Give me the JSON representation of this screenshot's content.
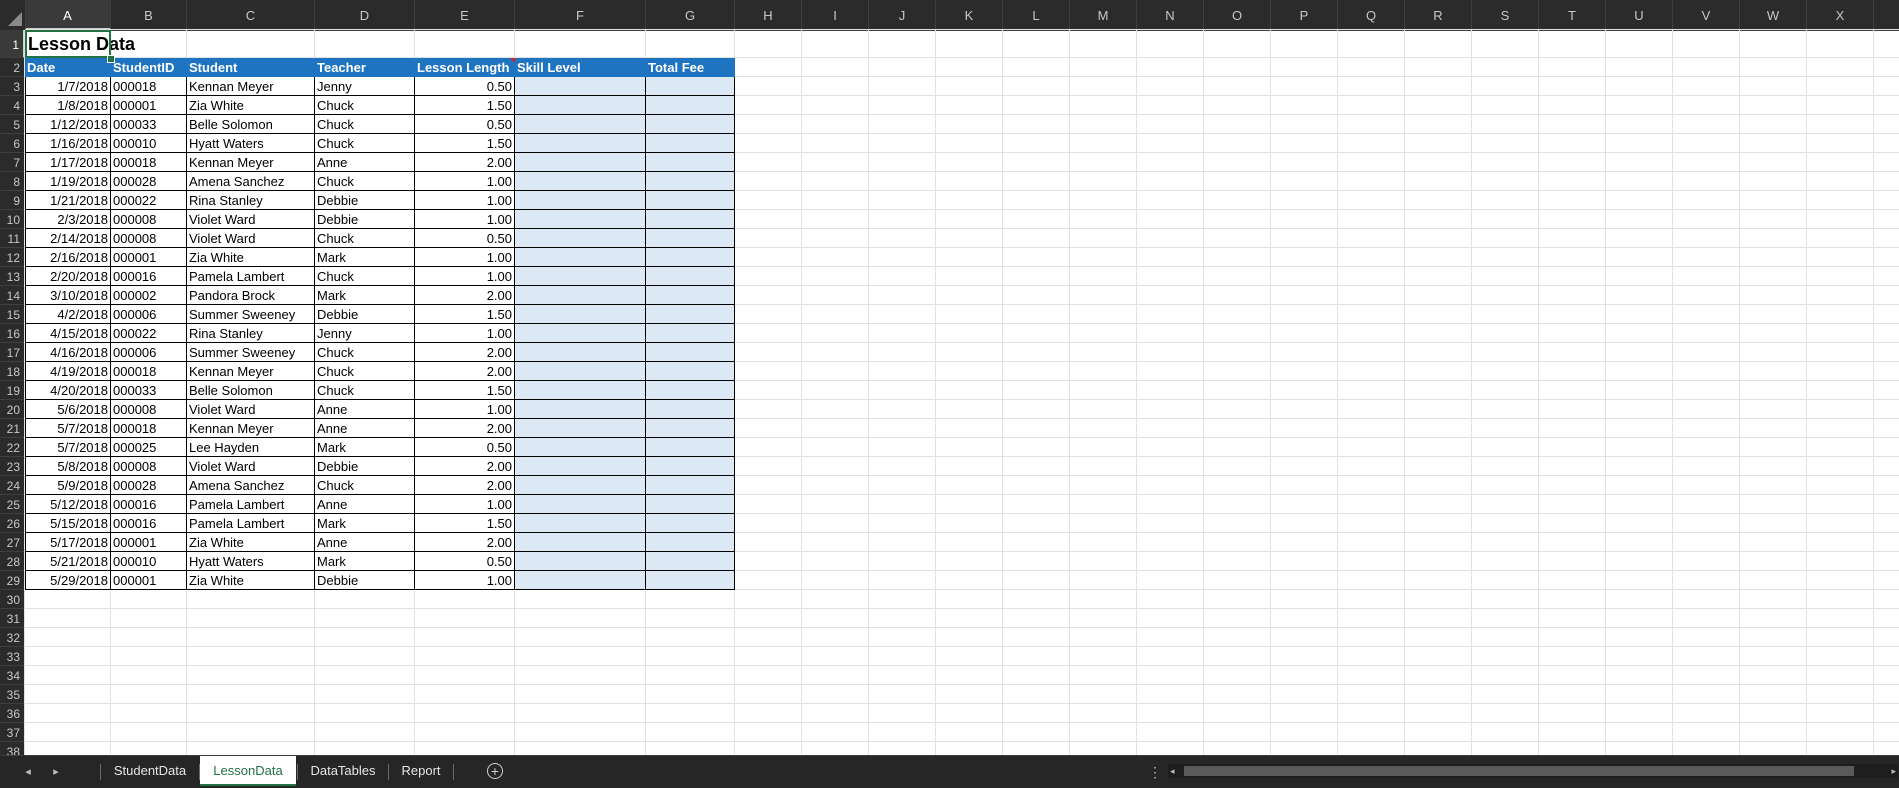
{
  "columns": [
    "A",
    "B",
    "C",
    "D",
    "E",
    "F",
    "G",
    "H",
    "I",
    "J",
    "K",
    "L",
    "M",
    "N",
    "O",
    "P",
    "Q",
    "R",
    "S",
    "T",
    "U",
    "V",
    "W",
    "X"
  ],
  "active_column": "A",
  "rows": [
    "1",
    "2",
    "3",
    "4",
    "5",
    "6",
    "7",
    "8",
    "9",
    "10",
    "11",
    "12",
    "13",
    "14",
    "15",
    "16",
    "17",
    "18",
    "19",
    "20",
    "21",
    "22",
    "23",
    "24",
    "25",
    "26",
    "27",
    "28",
    "29",
    "30",
    "31",
    "32",
    "33",
    "34",
    "35",
    "36",
    "37",
    "38"
  ],
  "active_row": "1",
  "sheet_title": "Lesson Data",
  "table_headers": [
    "Date",
    "StudentID",
    "Student",
    "Teacher",
    "Lesson Length",
    "Skill Level",
    "Total Fee"
  ],
  "table_rows": [
    [
      "1/7/2018",
      "000018",
      "Kennan Meyer",
      "Jenny",
      "0.50",
      "",
      ""
    ],
    [
      "1/8/2018",
      "000001",
      "Zia White",
      "Chuck",
      "1.50",
      "",
      ""
    ],
    [
      "1/12/2018",
      "000033",
      "Belle Solomon",
      "Chuck",
      "0.50",
      "",
      ""
    ],
    [
      "1/16/2018",
      "000010",
      "Hyatt Waters",
      "Chuck",
      "1.50",
      "",
      ""
    ],
    [
      "1/17/2018",
      "000018",
      "Kennan Meyer",
      "Anne",
      "2.00",
      "",
      ""
    ],
    [
      "1/19/2018",
      "000028",
      "Amena Sanchez",
      "Chuck",
      "1.00",
      "",
      ""
    ],
    [
      "1/21/2018",
      "000022",
      "Rina Stanley",
      "Debbie",
      "1.00",
      "",
      ""
    ],
    [
      "2/3/2018",
      "000008",
      "Violet Ward",
      "Debbie",
      "1.00",
      "",
      ""
    ],
    [
      "2/14/2018",
      "000008",
      "Violet Ward",
      "Chuck",
      "0.50",
      "",
      ""
    ],
    [
      "2/16/2018",
      "000001",
      "Zia White",
      "Mark",
      "1.00",
      "",
      ""
    ],
    [
      "2/20/2018",
      "000016",
      "Pamela Lambert",
      "Chuck",
      "1.00",
      "",
      ""
    ],
    [
      "3/10/2018",
      "000002",
      "Pandora Brock",
      "Mark",
      "2.00",
      "",
      ""
    ],
    [
      "4/2/2018",
      "000006",
      "Summer Sweeney",
      "Debbie",
      "1.50",
      "",
      ""
    ],
    [
      "4/15/2018",
      "000022",
      "Rina Stanley",
      "Jenny",
      "1.00",
      "",
      ""
    ],
    [
      "4/16/2018",
      "000006",
      "Summer Sweeney",
      "Chuck",
      "2.00",
      "",
      ""
    ],
    [
      "4/19/2018",
      "000018",
      "Kennan Meyer",
      "Chuck",
      "2.00",
      "",
      ""
    ],
    [
      "4/20/2018",
      "000033",
      "Belle Solomon",
      "Chuck",
      "1.50",
      "",
      ""
    ],
    [
      "5/6/2018",
      "000008",
      "Violet Ward",
      "Anne",
      "1.00",
      "",
      ""
    ],
    [
      "5/7/2018",
      "000018",
      "Kennan Meyer",
      "Anne",
      "2.00",
      "",
      ""
    ],
    [
      "5/7/2018",
      "000025",
      "Lee Hayden",
      "Mark",
      "0.50",
      "",
      ""
    ],
    [
      "5/8/2018",
      "000008",
      "Violet Ward",
      "Debbie",
      "2.00",
      "",
      ""
    ],
    [
      "5/9/2018",
      "000028",
      "Amena Sanchez",
      "Chuck",
      "2.00",
      "",
      ""
    ],
    [
      "5/12/2018",
      "000016",
      "Pamela Lambert",
      "Anne",
      "1.00",
      "",
      ""
    ],
    [
      "5/15/2018",
      "000016",
      "Pamela Lambert",
      "Mark",
      "1.50",
      "",
      ""
    ],
    [
      "5/17/2018",
      "000001",
      "Zia White",
      "Anne",
      "2.00",
      "",
      ""
    ],
    [
      "5/21/2018",
      "000010",
      "Hyatt Waters",
      "Mark",
      "0.50",
      "",
      ""
    ],
    [
      "5/29/2018",
      "000001",
      "Zia White",
      "Debbie",
      "1.00",
      "",
      ""
    ]
  ],
  "sheet_tabs": [
    {
      "label": "StudentData",
      "active": false
    },
    {
      "label": "LessonData",
      "active": true
    },
    {
      "label": "DataTables",
      "active": false
    },
    {
      "label": "Report",
      "active": false
    }
  ],
  "icons": {
    "nav_prev": "◂",
    "nav_next": "▸",
    "add_sheet": "+",
    "more": "⋮",
    "scroll_left": "◂",
    "scroll_right": "▸"
  },
  "colors": {
    "header_fill": "#1f74c2",
    "input_fill": "#dce9f5",
    "accent": "#217346"
  }
}
